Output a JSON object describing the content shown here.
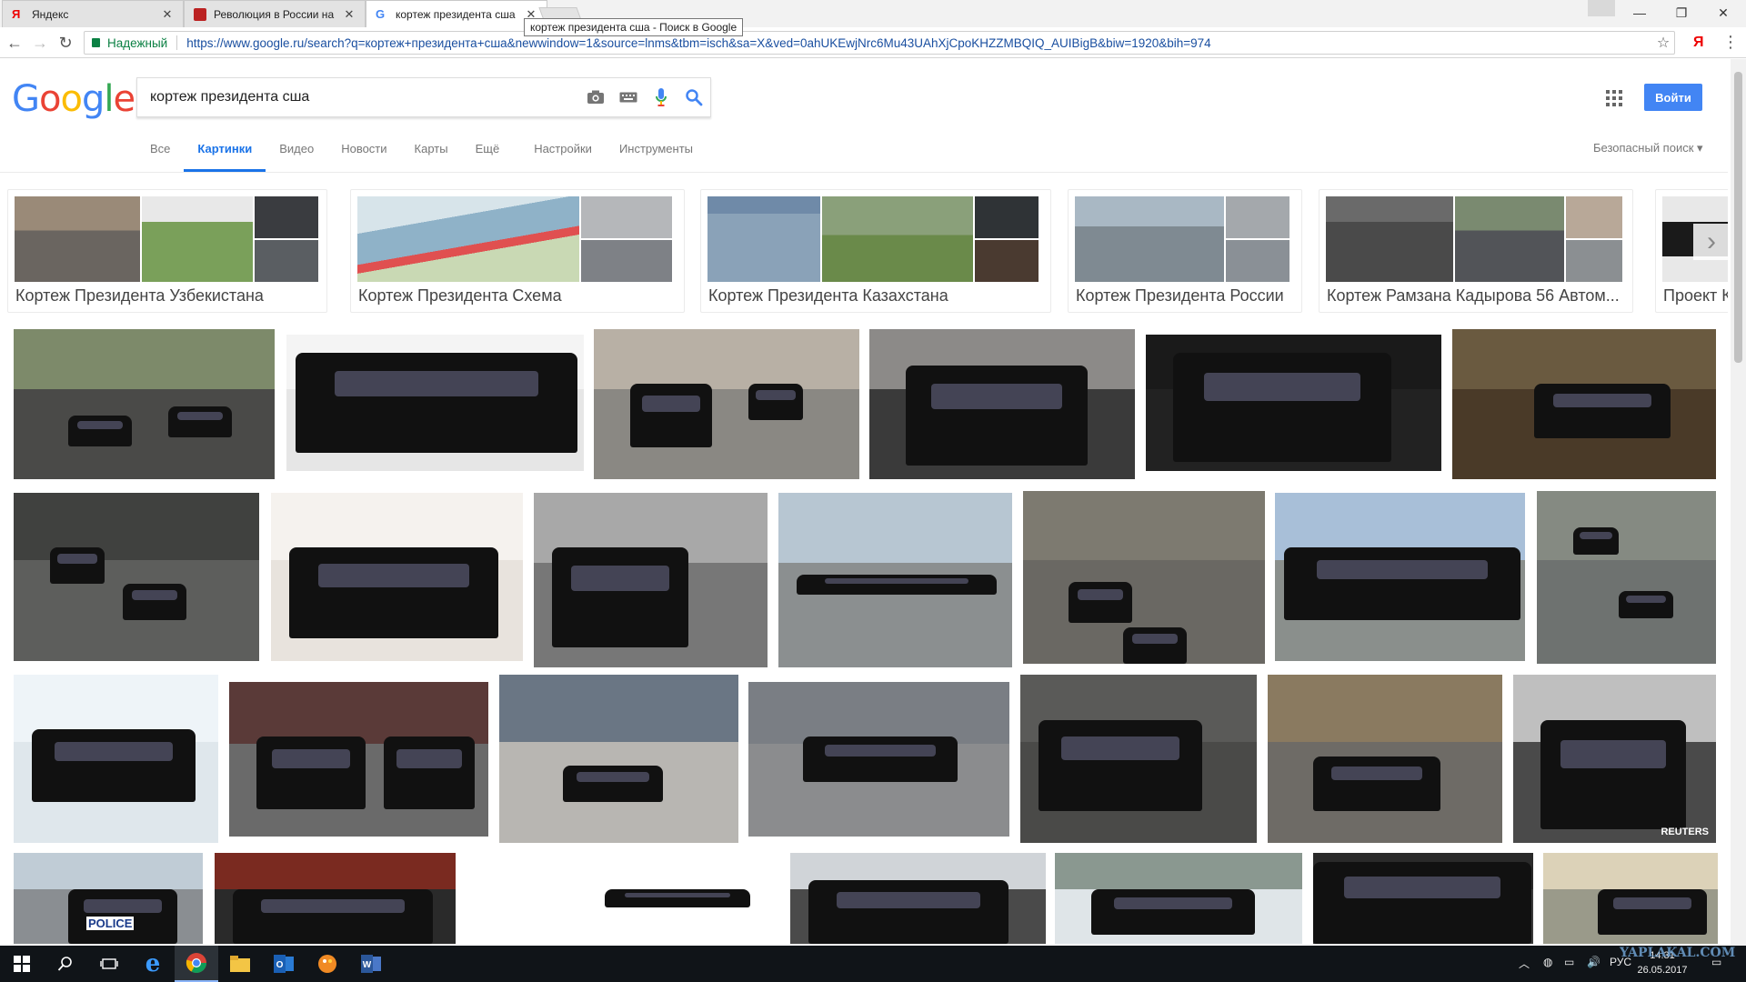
{
  "browser": {
    "tabs": [
      {
        "title": "Яндекс",
        "close": "✕",
        "active": false
      },
      {
        "title": "Революция в России на",
        "close": "✕",
        "active": false
      },
      {
        "title": "кортеж президента сша",
        "close": "✕",
        "active": true
      }
    ],
    "tooltip": "кортеж президента сша - Поиск в Google",
    "security_label": "Надежный",
    "url": "https://www.google.ru/search?q=кортеж+президента+сша&newwindow=1&source=lnms&tbm=isch&sa=X&ved=0ahUKEwjNrc6Mu43UAhXjCpoKHZZMBQIQ_AUIBigB&biw=1920&bih=974",
    "extension_label": "Я"
  },
  "google": {
    "logo_letters": [
      {
        "ch": "G",
        "color": "#4285f4"
      },
      {
        "ch": "o",
        "color": "#ea4335"
      },
      {
        "ch": "o",
        "color": "#fbbc05"
      },
      {
        "ch": "g",
        "color": "#4285f4"
      },
      {
        "ch": "l",
        "color": "#34a853"
      },
      {
        "ch": "e",
        "color": "#ea4335"
      }
    ],
    "query": "кортеж президента сша",
    "signin_label": "Войти",
    "tabs": [
      "Все",
      "Картинки",
      "Видео",
      "Новости",
      "Карты",
      "Ещё",
      "Настройки",
      "Инструменты"
    ],
    "active_tab": "Картинки",
    "safe_search": "Безопасный поиск ▾",
    "accent_color": "#1a73e8"
  },
  "chips": [
    {
      "label": "Кортеж Президента Узбекистана"
    },
    {
      "label": "Кортеж Президента Схема"
    },
    {
      "label": "Кортеж Президента Казахстана"
    },
    {
      "label": "Кортеж Президента России"
    },
    {
      "label": "Кортеж Рамзана Кадырова 56 Автом..."
    },
    {
      "label": "Проект Ко"
    }
  ],
  "images": {
    "reuters_caption": "REUTERS",
    "police_caption": "POLICE"
  },
  "taskbar": {
    "lang": "РУС",
    "time": "14:31",
    "date": "26.05.2017",
    "watermark": "YAPLAKAL.COM"
  }
}
